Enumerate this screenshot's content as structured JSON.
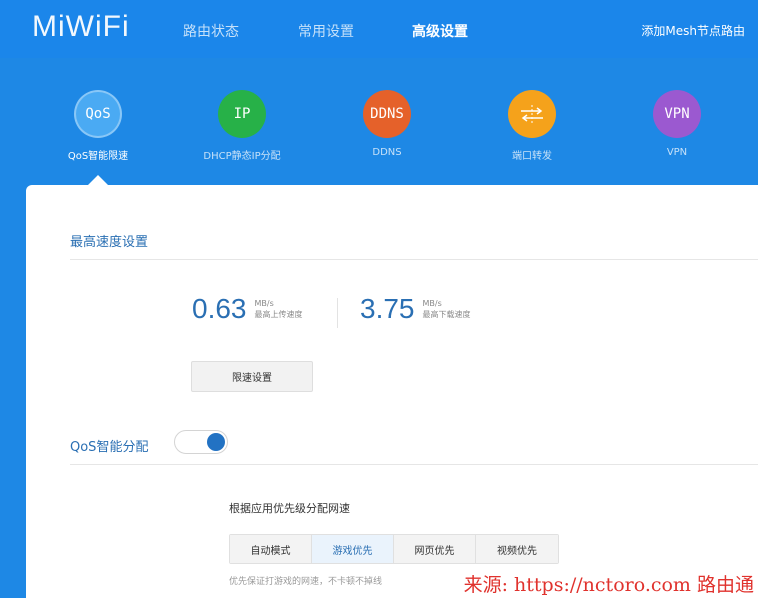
{
  "brand": {
    "logo_text": "MiWiFi"
  },
  "nav": {
    "items": [
      {
        "label": "路由状态"
      },
      {
        "label": "常用设置"
      },
      {
        "label": "高级设置"
      }
    ],
    "active_index": 2,
    "add_mesh_label": "添加Mesh节点路由"
  },
  "features": [
    {
      "icon_text": "QoS",
      "label": "QoS智能限速",
      "icon": "qos-icon",
      "color": "#4aaaf3"
    },
    {
      "icon_text": "IP",
      "label": "DHCP静态IP分配",
      "icon": "ip-icon",
      "color": "#27b148"
    },
    {
      "icon_text": "DDNS",
      "label": "DDNS",
      "icon": "ddns-icon",
      "color": "#e5612a"
    },
    {
      "icon_text": "",
      "label": "端口转发",
      "icon": "port-forward-icon",
      "color": "#f5a21b"
    },
    {
      "icon_text": "VPN",
      "label": "VPN",
      "icon": "vpn-icon",
      "color": "#9b59d0"
    }
  ],
  "max_speed": {
    "section_title": "最高速度设置",
    "upload": {
      "value": "0.63",
      "unit": "MB/s",
      "label": "最高上传速度"
    },
    "download": {
      "value": "3.75",
      "unit": "MB/s",
      "label": "最高下载速度"
    },
    "limit_button_label": "限速设置"
  },
  "qos": {
    "label": "QoS智能分配",
    "enabled": true,
    "allocation_title": "根据应用优先级分配网速",
    "modes": [
      {
        "label": "自动模式"
      },
      {
        "label": "游戏优先"
      },
      {
        "label": "网页优先"
      },
      {
        "label": "视频优先"
      }
    ],
    "active_mode_index": 1,
    "hint": "优先保证打游戏的网速，不卡顿不掉线"
  },
  "watermark": {
    "text": "来源: https://nctoro.com 路由通"
  },
  "colors": {
    "header_blue": "#1e88e5",
    "accent_text": "#2a6fb3",
    "toggle_knob": "#2272c3",
    "watermark_red": "#e0322d"
  }
}
